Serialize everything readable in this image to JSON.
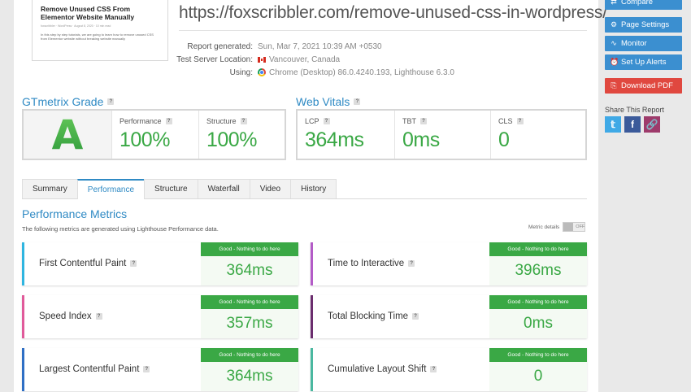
{
  "thumbnail": {
    "title": "Remove Unused CSS From Elementor Website Manually",
    "meta": "foxscribbler · WordPress · August 8, 2020 · 10 min read",
    "body": "In this step by step tutorials, we are going to learn how to remove unused CSS from Elementor website without breaking website manually"
  },
  "report": {
    "url": "https://foxscribbler.com/remove-unused-css-in-wordpress/",
    "generated_label": "Report generated:",
    "generated_value": "Sun, Mar 7, 2021 10:39 AM +0530",
    "location_label": "Test Server Location:",
    "location_value": "Vancouver, Canada",
    "using_label": "Using:",
    "using_value": "Chrome (Desktop) 86.0.4240.193, Lighthouse 6.3.0"
  },
  "grade": {
    "title": "GTmetrix Grade",
    "letter": "A",
    "performance_label": "Performance",
    "performance_value": "100%",
    "structure_label": "Structure",
    "structure_value": "100%"
  },
  "vitals": {
    "title": "Web Vitals",
    "lcp_label": "LCP",
    "lcp_value": "364ms",
    "tbt_label": "TBT",
    "tbt_value": "0ms",
    "cls_label": "CLS",
    "cls_value": "0"
  },
  "tabs": [
    "Summary",
    "Performance",
    "Structure",
    "Waterfall",
    "Video",
    "History"
  ],
  "active_tab": "Performance",
  "performance": {
    "title": "Performance Metrics",
    "subtitle": "The following metrics are generated using Lighthouse Performance data.",
    "details_label": "Metric details",
    "toggle_label": "OFF",
    "metrics": [
      {
        "name": "First Contentful Paint",
        "badge": "Good - Nothing to do here",
        "value": "364ms",
        "color": "#2fb5e0"
      },
      {
        "name": "Time to Interactive",
        "badge": "Good - Nothing to do here",
        "value": "396ms",
        "color": "#b35bc7"
      },
      {
        "name": "Speed Index",
        "badge": "Good - Nothing to do here",
        "value": "357ms",
        "color": "#e05a9a"
      },
      {
        "name": "Total Blocking Time",
        "badge": "Good - Nothing to do here",
        "value": "0ms",
        "color": "#6b2d6e"
      },
      {
        "name": "Largest Contentful Paint",
        "badge": "Good - Nothing to do here",
        "value": "364ms",
        "color": "#2f6fc4"
      },
      {
        "name": "Cumulative Layout Shift",
        "badge": "Good - Nothing to do here",
        "value": "0",
        "color": "#4ab8a0"
      }
    ]
  },
  "sidebar": {
    "compare": "Compare",
    "page_settings": "Page Settings",
    "monitor": "Monitor",
    "alerts": "Set Up Alerts",
    "download": "Download PDF",
    "share_label": "Share This Report"
  },
  "colors": {
    "accent": "#2f8ac4",
    "good": "#3aa845",
    "pdf": "#e0483f"
  }
}
